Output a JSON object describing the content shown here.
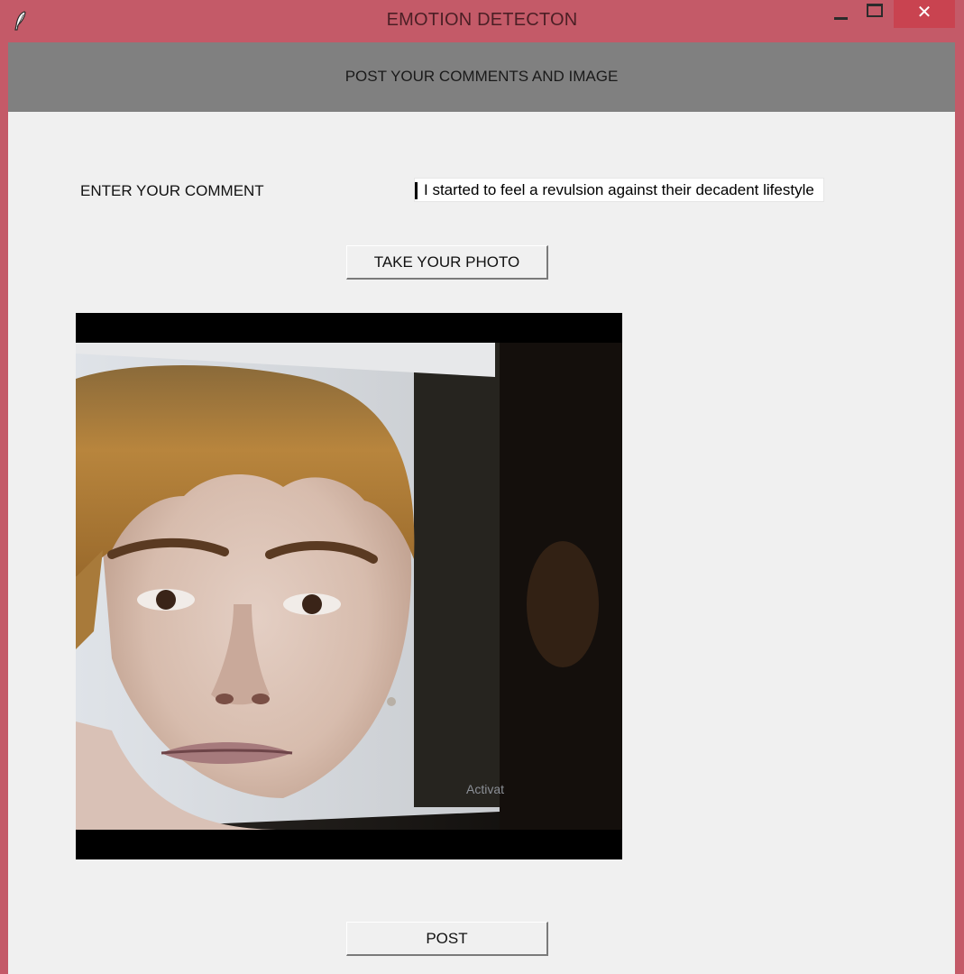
{
  "window": {
    "title": "EMOTION DETECTON",
    "close_glyph": "✕"
  },
  "header": {
    "title": "POST YOUR COMMENTS AND IMAGE"
  },
  "form": {
    "comment_label": "ENTER YOUR COMMENT",
    "comment_value": "I started to feel a revulsion against their decadent lifestyle",
    "take_photo_label": "TAKE YOUR PHOTO",
    "post_label": "POST"
  },
  "photo": {
    "overlay_text": "Activat"
  },
  "colors": {
    "window_frame": "#c45a68",
    "close_button": "#c94350",
    "header_band": "#808080",
    "client_background": "#f0f0f0"
  },
  "icons": {
    "app": "feather-icon",
    "minimize": "minimize-icon",
    "maximize": "maximize-icon",
    "close": "close-icon"
  }
}
